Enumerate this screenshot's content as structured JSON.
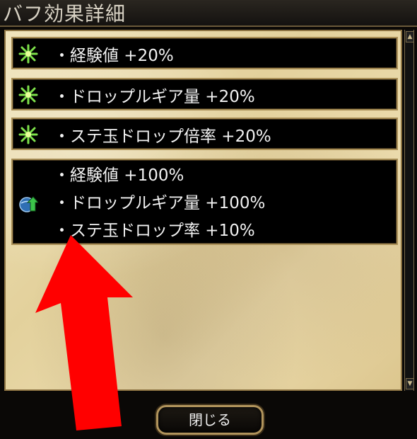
{
  "window": {
    "title": "バフ効果詳細"
  },
  "buffs": [
    {
      "icon": "green-sparkle-icon",
      "lines": [
        "・経験値 +20%"
      ]
    },
    {
      "icon": "green-sparkle-icon",
      "lines": [
        "・ドロップルギア量 +20%"
      ]
    },
    {
      "icon": "green-sparkle-icon",
      "lines": [
        "・ステ玉ドロップ倍率 +20%"
      ]
    },
    {
      "icon": "globe-arrow-icon",
      "lines": [
        "・経験値 +100%",
        "・ドロップルギア量 +100%",
        "・ステ玉ドロップ率 +10%"
      ]
    }
  ],
  "footer": {
    "close_label": "閉じる"
  },
  "annotation": {
    "arrow_color": "#ff0000"
  }
}
